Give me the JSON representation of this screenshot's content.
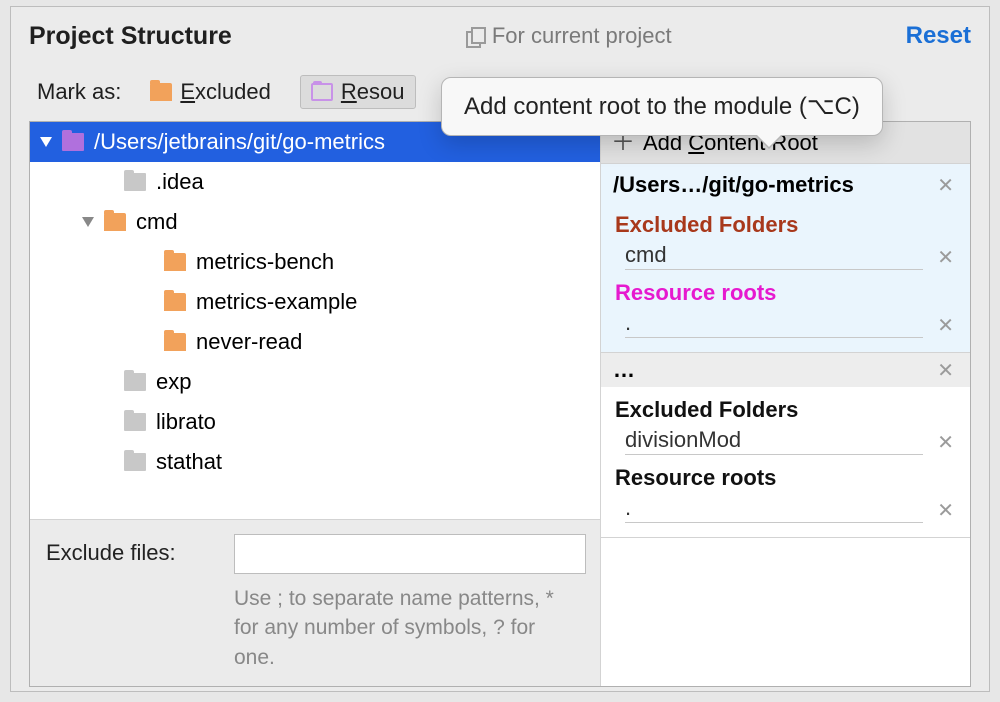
{
  "header": {
    "title": "Project Structure",
    "scope_label": "For current project",
    "reset_label": "Reset"
  },
  "tooltip": {
    "text": "Add content root to the module (⌥C)"
  },
  "markas": {
    "label": "Mark as:",
    "excluded_prefix": "E",
    "excluded_rest": "xcluded",
    "resource_prefix": "R",
    "resource_rest": "esou"
  },
  "tree": {
    "root": "/Users/jetbrains/git/go-metrics",
    "idea": ".idea",
    "cmd": "cmd",
    "metrics_bench": "metrics-bench",
    "metrics_example": "metrics-example",
    "never_read": "never-read",
    "exp": "exp",
    "librato": "librato",
    "stathat": "stathat"
  },
  "exclude": {
    "label": "Exclude files:",
    "value": "",
    "hint": "Use ; to separate name patterns, * for any number of symbols, ? for one."
  },
  "right": {
    "add_root_prefix": "Add ",
    "add_root_underline": "C",
    "add_root_rest": "ontent Root",
    "root1": {
      "path": "/Users…/git/go-metrics",
      "excluded_title": "Excluded Folders",
      "excluded_item": "cmd",
      "resource_title": "Resource roots",
      "resource_item": "."
    },
    "root2": {
      "path": "…",
      "excluded_title": "Excluded Folders",
      "excluded_item": "divisionMod",
      "resource_title": "Resource roots",
      "resource_item": "."
    }
  }
}
